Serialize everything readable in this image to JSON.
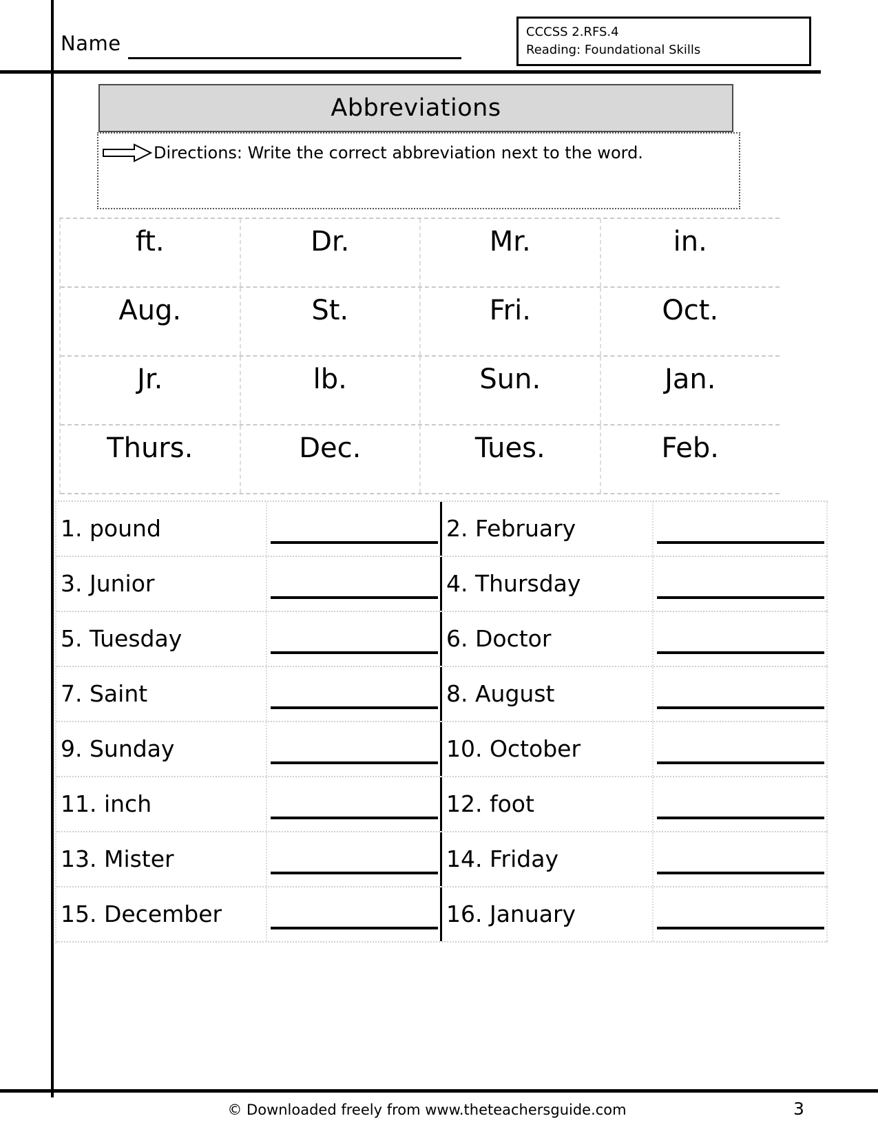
{
  "header": {
    "name_label": "Name",
    "standard_code": "CCCSS 2.RFS.4",
    "standard_subject": "Reading: Foundational Skills"
  },
  "title": {
    "text": "Abbreviations"
  },
  "directions": {
    "icon": "arrow-right-icon",
    "text": "Directions: Write the correct abbreviation next to the word."
  },
  "word_bank": {
    "rows": [
      [
        "ft.",
        "Dr.",
        "Mr.",
        "in."
      ],
      [
        "Aug.",
        "St.",
        "Fri.",
        "Oct."
      ],
      [
        "Jr.",
        "lb.",
        "Sun.",
        "Jan."
      ],
      [
        "Thurs.",
        "Dec.",
        "Tues.",
        "Feb."
      ]
    ]
  },
  "questions": {
    "rows": [
      {
        "left": "1. pound",
        "right": "2. February"
      },
      {
        "left": "3. Junior",
        "right": "4. Thursday"
      },
      {
        "left": "5. Tuesday",
        "right": "6. Doctor"
      },
      {
        "left": "7. Saint",
        "right": "8. August"
      },
      {
        "left": "9. Sunday",
        "right": "10. October"
      },
      {
        "left": "11. inch",
        "right": "12. foot"
      },
      {
        "left": "13. Mister",
        "right": "14. Friday"
      },
      {
        "left": "15. December",
        "right": "16. January"
      }
    ]
  },
  "footer": {
    "credit": "© Downloaded freely from www.theteachersguide.com",
    "page_number": "3"
  },
  "colors": {
    "title_bg": "#d8d8d8",
    "title_border": "#4a4a4a",
    "rule": "#000000",
    "grid_dash": "#cfcfcf"
  }
}
